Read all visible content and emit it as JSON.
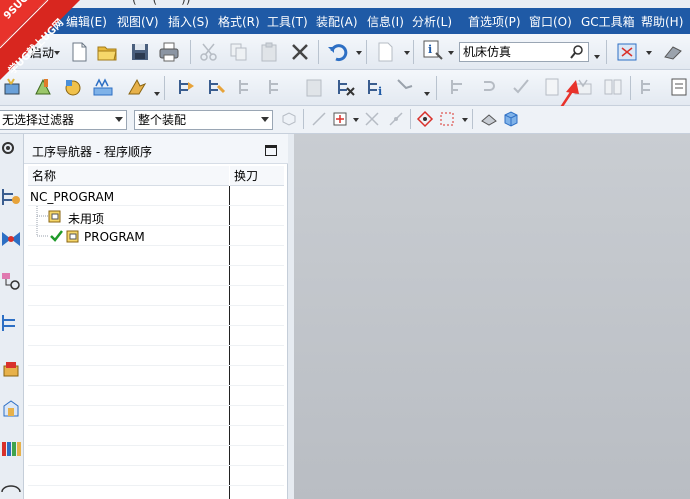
{
  "window": {
    "title_fragment": "—(— (——))"
  },
  "menu": [
    {
      "label": "编辑(E)"
    },
    {
      "label": "视图(V)"
    },
    {
      "label": "插入(S)"
    },
    {
      "label": "格式(R)"
    },
    {
      "label": "工具(T)"
    },
    {
      "label": "装配(A)"
    },
    {
      "label": "信息(I)"
    },
    {
      "label": "分析(L)"
    },
    {
      "label": "首选项(P)"
    },
    {
      "label": "窗口(O)"
    },
    {
      "label": "GC工具箱"
    },
    {
      "label": "帮助(H)"
    }
  ],
  "logo": {
    "text_top": "9SUG",
    "text_bottom": "学UG就上UG网"
  },
  "toolbar1": {
    "start_label": "启动",
    "command_search": "机床仿真"
  },
  "filters": {
    "selection_filter": "无选择过滤器",
    "assembly_scope": "整个装配"
  },
  "navigator": {
    "title": "工序导航器 - 程序顺序",
    "columns": {
      "name": "名称",
      "tool_change": "换刀"
    },
    "rows": [
      {
        "label": "NC_PROGRAM"
      },
      {
        "label": "未用项"
      },
      {
        "label": "PROGRAM"
      }
    ]
  },
  "colors": {
    "menubar": "#1f5aa6",
    "graphics_bg": "#c2c6cb",
    "annotation_arrow": "#e8322b",
    "checkmark": "#1f9a2a"
  }
}
